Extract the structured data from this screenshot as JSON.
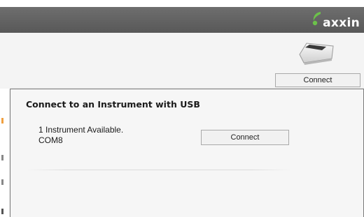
{
  "app": {
    "brand": "axxin",
    "brand_color": "#6cc24a",
    "device_image": "instrument-device-icon",
    "connect_button_label": "Connect"
  },
  "dialog": {
    "title": "Connect to an Instrument with USB",
    "status_text": "1 Instrument Available.",
    "port": "COM8",
    "connect_button_label": "Connect"
  }
}
